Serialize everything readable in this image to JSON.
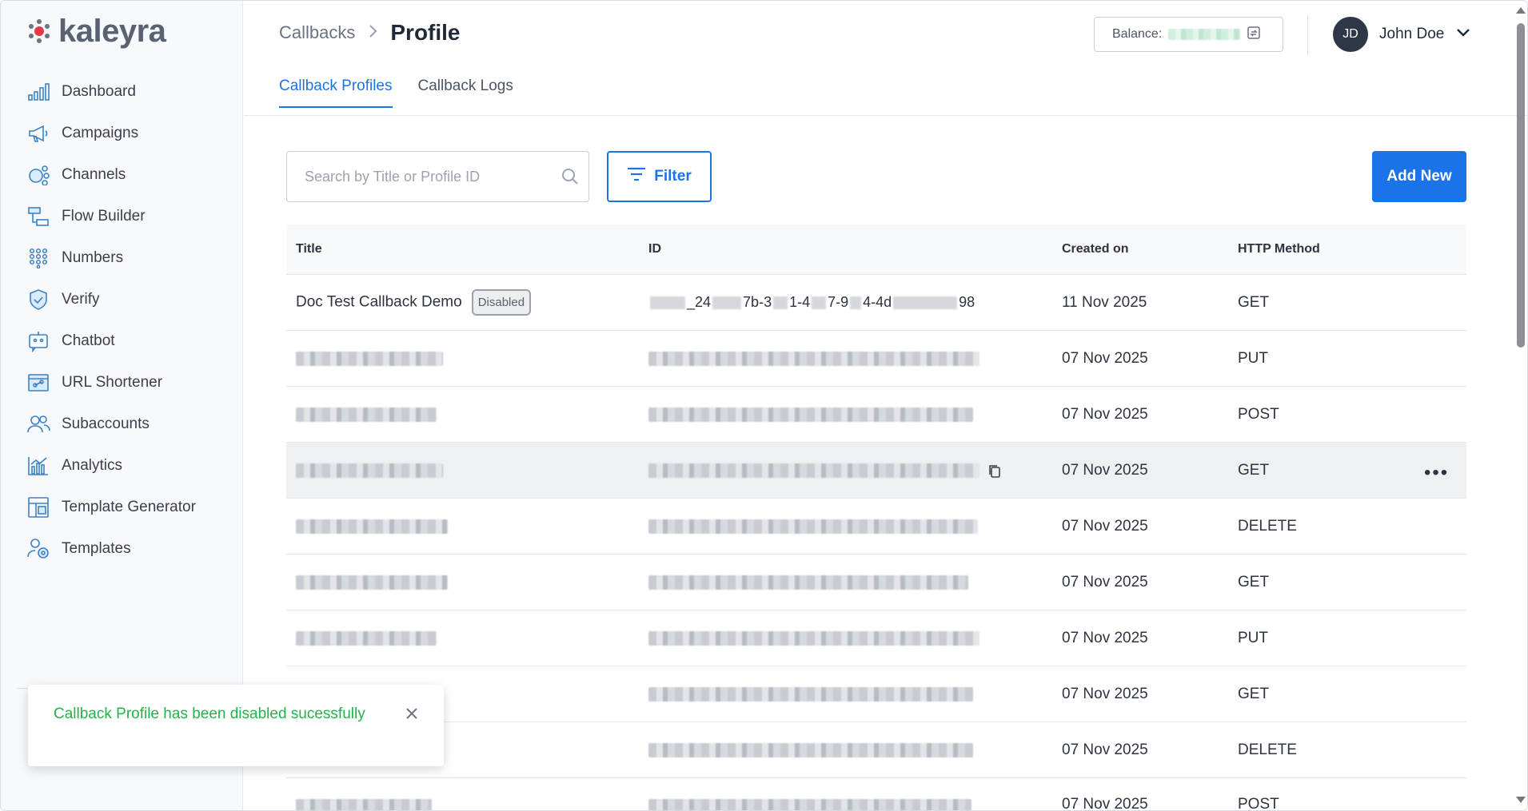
{
  "brand": {
    "name": "kaleyra",
    "accent": "#1a73e8",
    "logo_dot": "#e63946"
  },
  "sidebar": {
    "items": [
      {
        "label": "Dashboard",
        "icon": "bar-chart-icon"
      },
      {
        "label": "Campaigns",
        "icon": "megaphone-icon"
      },
      {
        "label": "Channels",
        "icon": "channels-icon"
      },
      {
        "label": "Flow Builder",
        "icon": "flow-builder-icon"
      },
      {
        "label": "Numbers",
        "icon": "dial-pad-icon"
      },
      {
        "label": "Verify",
        "icon": "shield-check-icon"
      },
      {
        "label": "Chatbot",
        "icon": "chatbot-icon"
      },
      {
        "label": "URL Shortener",
        "icon": "link-icon"
      },
      {
        "label": "Subaccounts",
        "icon": "users-icon"
      },
      {
        "label": "Analytics",
        "icon": "analytics-icon"
      },
      {
        "label": "Template Generator",
        "icon": "template-generator-icon"
      },
      {
        "label": "Templates",
        "icon": "templates-icon"
      }
    ]
  },
  "header": {
    "breadcrumb_parent": "Callbacks",
    "breadcrumb_current": "Profile",
    "balance_label": "Balance:",
    "user_initials": "JD",
    "user_name": "John Doe"
  },
  "tabs": [
    {
      "label": "Callback Profiles",
      "active": true
    },
    {
      "label": "Callback Logs",
      "active": false
    }
  ],
  "toolbar": {
    "search_placeholder": "Search by Title or Profile ID",
    "filter_label": "Filter",
    "add_label": "Add New"
  },
  "table": {
    "columns": [
      "Title",
      "ID",
      "Created on",
      "HTTP Method"
    ],
    "first_row": {
      "title": "Doc Test Callback Demo",
      "badge": "Disabled",
      "id_parts": [
        "_24",
        "7b-3",
        "1-4",
        "7-9",
        "4-4d",
        "98"
      ],
      "created": "11 Nov 2025",
      "method": "GET"
    },
    "rows": [
      {
        "created": "07 Nov 2025",
        "method": "PUT"
      },
      {
        "created": "07 Nov 2025",
        "method": "POST"
      },
      {
        "created": "07 Nov 2025",
        "method": "GET"
      },
      {
        "created": "07 Nov 2025",
        "method": "DELETE"
      },
      {
        "created": "07 Nov 2025",
        "method": "GET"
      },
      {
        "created": "07 Nov 2025",
        "method": "PUT"
      },
      {
        "created": "07 Nov 2025",
        "method": "GET"
      },
      {
        "created": "07 Nov 2025",
        "method": "DELETE"
      },
      {
        "created": "07 Nov 2025",
        "method": "POST"
      }
    ],
    "row_actions": "•••"
  },
  "toast": {
    "message": "Callback Profile has been disabled sucessfully",
    "color": "#22b34a"
  }
}
